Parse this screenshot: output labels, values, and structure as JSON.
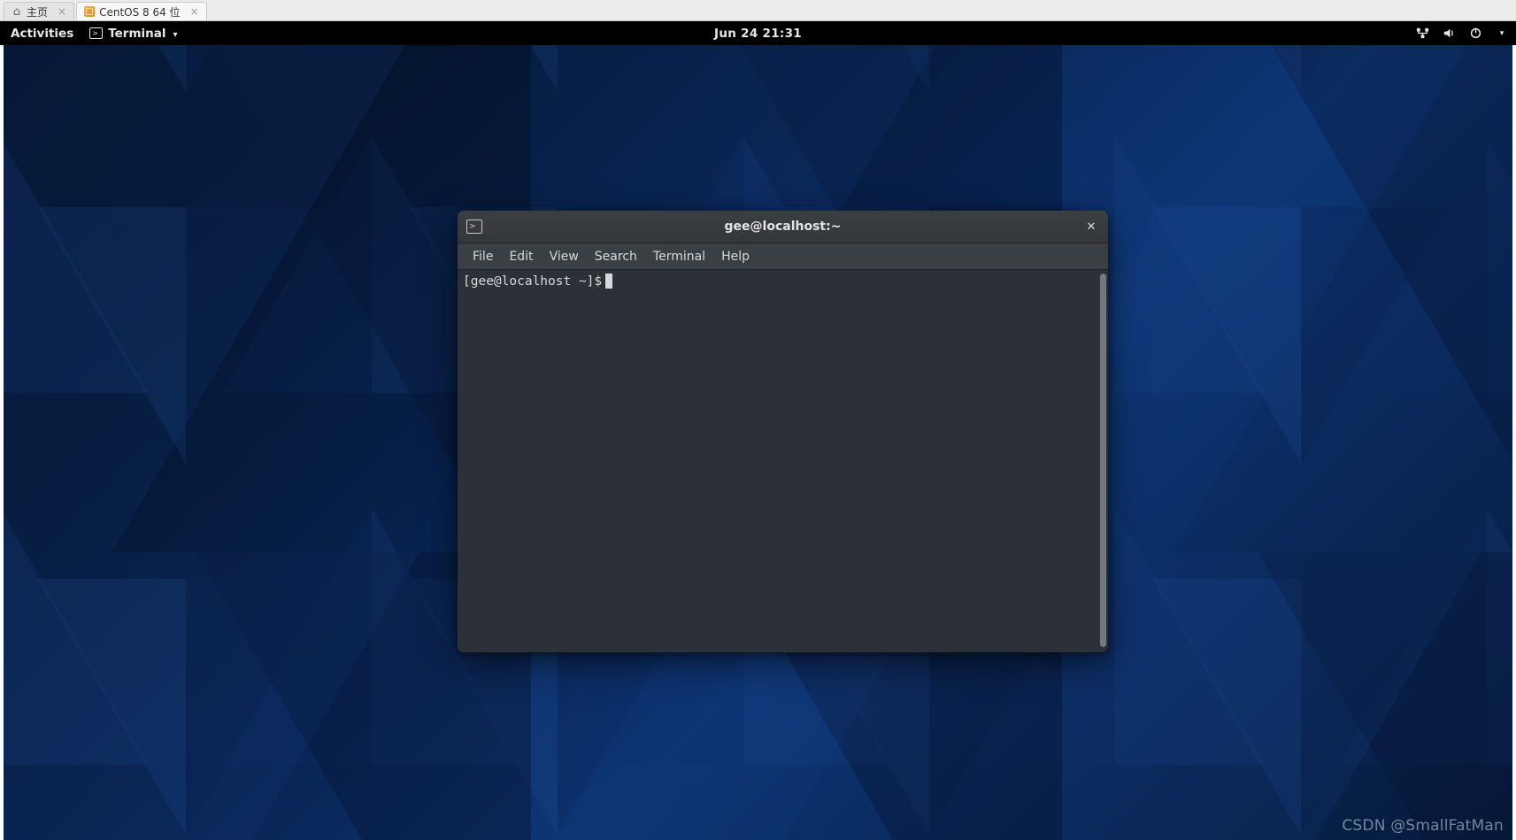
{
  "vm_tabs": {
    "home_label": "主页",
    "vm_label": "CentOS 8 64 位"
  },
  "topbar": {
    "activities": "Activities",
    "app_name": "Terminal",
    "datetime": "Jun 24  21:31"
  },
  "terminal": {
    "title": "gee@localhost:~",
    "menu": {
      "file": "File",
      "edit": "Edit",
      "view": "View",
      "search": "Search",
      "terminal": "Terminal",
      "help": "Help"
    },
    "prompt": "[gee@localhost ~]$"
  },
  "watermark": "CSDN @SmallFatMan"
}
